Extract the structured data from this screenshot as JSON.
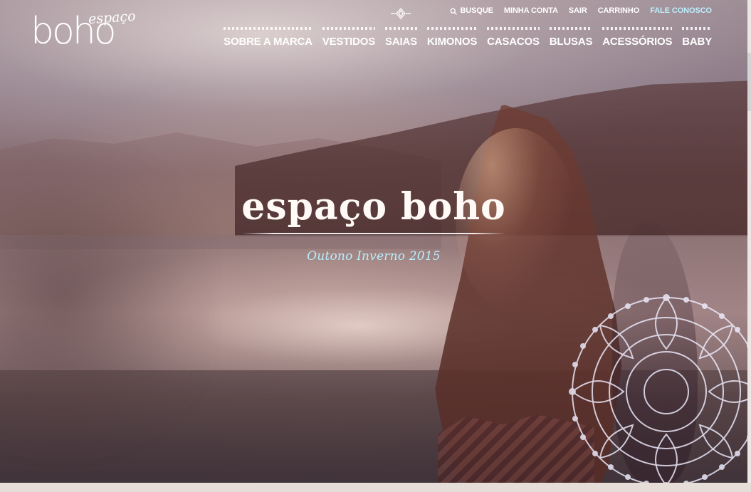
{
  "header": {
    "logo_main": "boho",
    "logo_sub": "espaço",
    "top_links": [
      {
        "label": "BUSQUE",
        "icon": "search-icon"
      },
      {
        "label": "MINHA CONTA"
      },
      {
        "label": "SAIR"
      },
      {
        "label": "CARRINHO"
      },
      {
        "label": "FALE CONOSCO"
      }
    ],
    "main_nav": [
      {
        "label": "SOBRE A MARCA"
      },
      {
        "label": "VESTIDOS"
      },
      {
        "label": "SAIAS"
      },
      {
        "label": "KIMONOS"
      },
      {
        "label": "CASACOS"
      },
      {
        "label": "BLUSAS"
      },
      {
        "label": "ACESSÓRIOS"
      },
      {
        "label": "BABY"
      }
    ],
    "ornament_icon": "diamond-ornament-icon"
  },
  "hero": {
    "title": "espaço boho",
    "subtitle": "Outono Inverno 2015"
  },
  "colors": {
    "accent_text": "#b7efff",
    "nav_text": "#ffffff",
    "scroll_track": "#ece7e5"
  }
}
